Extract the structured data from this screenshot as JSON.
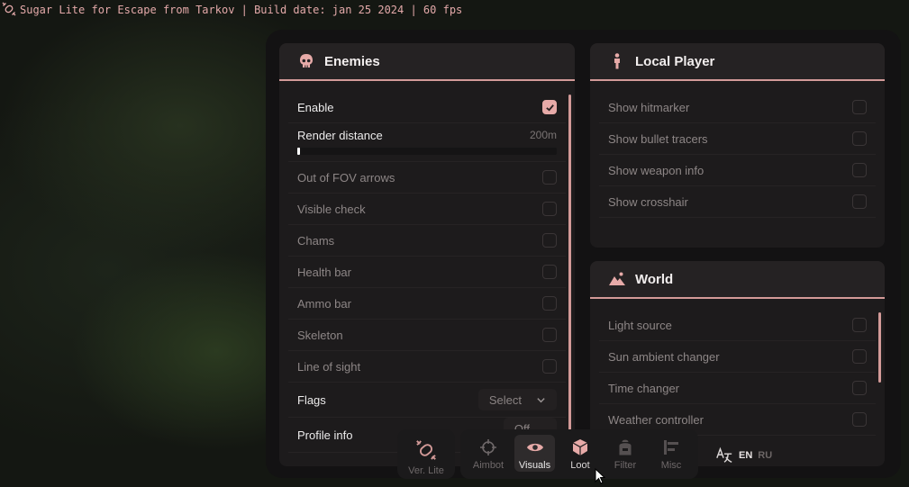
{
  "overlay": {
    "title": "Sugar Lite for Escape from Tarkov | Build date: jan 25 2024 | 60 fps",
    "icon": "candy-icon"
  },
  "accent_color": "#d39a98",
  "enemies": {
    "title": "Enemies",
    "icon": "skull-icon",
    "enable": {
      "label": "Enable",
      "checked": true
    },
    "render_distance": {
      "label": "Render distance",
      "value": "200m"
    },
    "toggles": [
      {
        "label": "Out of FOV arrows",
        "checked": false
      },
      {
        "label": "Visible check",
        "checked": false
      },
      {
        "label": "Chams",
        "checked": false
      },
      {
        "label": "Health bar",
        "checked": false
      },
      {
        "label": "Ammo bar",
        "checked": false
      },
      {
        "label": "Skeleton",
        "checked": false
      },
      {
        "label": "Line of sight",
        "checked": false
      }
    ],
    "flags": {
      "label": "Flags",
      "value": "Select"
    },
    "profile_info": {
      "label": "Profile info",
      "value": "Off"
    }
  },
  "local_player": {
    "title": "Local Player",
    "icon": "person-icon",
    "toggles": [
      {
        "label": "Show hitmarker",
        "checked": false
      },
      {
        "label": "Show bullet tracers",
        "checked": false
      },
      {
        "label": "Show weapon info",
        "checked": false
      },
      {
        "label": "Show crosshair",
        "checked": false
      }
    ]
  },
  "world": {
    "title": "World",
    "icon": "mountains-icon",
    "toggles": [
      {
        "label": "Light source",
        "checked": false
      },
      {
        "label": "Sun ambient changer",
        "checked": false
      },
      {
        "label": "Time changer",
        "checked": false
      },
      {
        "label": "Weather controller",
        "checked": false
      }
    ]
  },
  "dock": {
    "version": "Ver. Lite",
    "tabs": [
      {
        "label": "Aimbot",
        "icon": "crosshair-icon"
      },
      {
        "label": "Visuals",
        "icon": "eye-icon",
        "selected": true
      },
      {
        "label": "Loot",
        "icon": "box-icon"
      },
      {
        "label": "Filter",
        "icon": "backpack-icon"
      },
      {
        "label": "Misc",
        "icon": "sliders-icon"
      }
    ],
    "languages": [
      "EN",
      "RU"
    ],
    "active_language": "EN"
  }
}
